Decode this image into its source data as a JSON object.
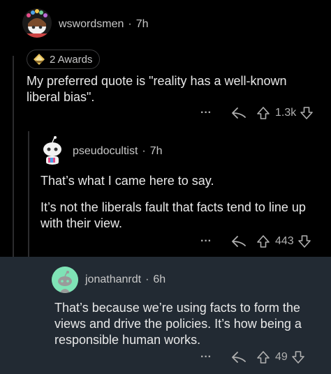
{
  "comments": [
    {
      "username": "wswordsmen",
      "age": "7h",
      "awards_label": "2 Awards",
      "body": "My preferred quote is \"reality has a well-known liberal bias\".",
      "score": "1.3k",
      "more": "···"
    },
    {
      "username": "pseudocultist",
      "age": "7h",
      "body_p1": "That’s what I came here to say.",
      "body_p2": "It’s not the liberals fault that facts tend to line up with their view.",
      "score": "443",
      "more": "···"
    },
    {
      "username": "jonathanrdt",
      "age": "6h",
      "body": "That’s because we’re using facts to form the views and drive the policies. It’s how being a responsible human works.",
      "score": "49",
      "more": "···"
    }
  ],
  "separator": "·",
  "colors": {
    "background": "#000000",
    "highlight_background": "#222a33",
    "avatar3_background": "#7fe3b6",
    "text_primary": "#e8e8e8",
    "text_secondary": "#c8c8c8"
  },
  "icons": [
    "reply-icon",
    "upvote-icon",
    "downvote-icon",
    "more-icon",
    "award-icon"
  ]
}
